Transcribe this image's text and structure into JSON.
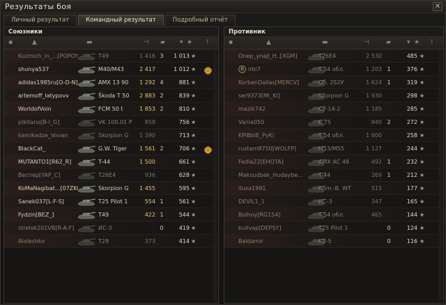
{
  "window": {
    "title": "Результаты боя",
    "close_glyph": "✕"
  },
  "tabs": [
    {
      "label": "Личный результат",
      "active": false
    },
    {
      "label": "Командный результат",
      "active": true
    },
    {
      "label": "Подробный отчёт",
      "active": false
    }
  ],
  "allies": {
    "title": "Союзники",
    "rows": [
      {
        "player": "Kuzmich_in_...[POPOY]",
        "vehicle": "T49",
        "damage": "1 416",
        "kills": "3",
        "xp": "1 013",
        "alive": false,
        "damage_low": true,
        "medal": false
      },
      {
        "player": "shunya537",
        "vehicle": "M40/M43",
        "damage": "2 417",
        "kills": "",
        "xp": "1 012",
        "alive": true,
        "damage_low": false,
        "medal": true
      },
      {
        "player": "adidas1985ru[O-D-N]",
        "vehicle": "AMX 13 90",
        "damage": "1 292",
        "kills": "4",
        "xp": "881",
        "alive": true,
        "damage_low": false,
        "medal": false
      },
      {
        "player": "artemoff_latypovv",
        "vehicle": "Škoda T 50",
        "damage": "2 883",
        "kills": "2",
        "xp": "839",
        "alive": true,
        "damage_low": false,
        "medal": false
      },
      {
        "player": "WorldofVoin",
        "vehicle": "FCM 50 t",
        "damage": "1 853",
        "kills": "2",
        "xp": "810",
        "alive": true,
        "damage_low": false,
        "medal": false
      },
      {
        "player": "pikitano[B-I_G]",
        "vehicle": "VK 100.01 P",
        "damage": "858",
        "kills": "",
        "xp": "756",
        "alive": false,
        "damage_low": true,
        "medal": false
      },
      {
        "player": "kamikadze_Vovan",
        "vehicle": "Skorpion G",
        "damage": "1 390",
        "kills": "",
        "xp": "713",
        "alive": false,
        "damage_low": true,
        "medal": false
      },
      {
        "player": "BlackCat_",
        "vehicle": "G.W. Tiger",
        "damage": "1 561",
        "kills": "2",
        "xp": "706",
        "alive": true,
        "damage_low": false,
        "medal": true
      },
      {
        "player": "MUTANTO1[R62_R]",
        "vehicle": "T-44",
        "damage": "1 500",
        "kills": "",
        "xp": "661",
        "alive": true,
        "damage_low": false,
        "medal": false
      },
      {
        "player": "Веспер[YAP_C]",
        "vehicle": "T26E4",
        "damage": "936",
        "kills": "",
        "xp": "628",
        "alive": false,
        "damage_low": true,
        "medal": false
      },
      {
        "player": "KoMaNagibat...[07ZKO]",
        "vehicle": "Skorpion G",
        "damage": "1 455",
        "kills": "",
        "xp": "595",
        "alive": true,
        "damage_low": false,
        "medal": false
      },
      {
        "player": "Sanek037[L-F-S]",
        "vehicle": "T25 Pilot 1",
        "damage": "554",
        "kills": "1",
        "xp": "561",
        "alive": true,
        "damage_low": false,
        "medal": false
      },
      {
        "player": "Fydzin[BEZ_]",
        "vehicle": "T49",
        "damage": "422",
        "kills": "1",
        "xp": "544",
        "alive": true,
        "damage_low": false,
        "medal": false
      },
      {
        "player": "strelok201VB[R-A-F]",
        "vehicle": "ИС-3",
        "damage": "",
        "kills": "0",
        "xp": "419",
        "alive": false,
        "damage_low": true,
        "medal": false
      },
      {
        "player": "Aloleshko",
        "vehicle": "T28",
        "damage": "373",
        "kills": "",
        "xp": "414",
        "alive": false,
        "damage_low": true,
        "medal": false
      }
    ]
  },
  "enemies": {
    "title": "Противник",
    "rows": [
      {
        "player": "Onep_ynaJl_H..[XGM]",
        "vehicle": "T26E4",
        "damage": "2 530",
        "kills": "",
        "xp": "485",
        "alive": false,
        "damage_low": true,
        "platoon": false
      },
      {
        "player": "irbi7",
        "vehicle": "T-54 обл.",
        "damage": "1 203",
        "kills": "1",
        "xp": "376",
        "alive": false,
        "damage_low": true,
        "platoon": true
      },
      {
        "player": "KorbenDallas[MERCV]",
        "vehicle": "Об. 252У",
        "damage": "1 624",
        "kills": "1",
        "xp": "319",
        "alive": false,
        "damage_low": true,
        "platoon": false
      },
      {
        "player": "ser9373[MI_KI]",
        "vehicle": "Skorpion G",
        "damage": "1 930",
        "kills": "",
        "xp": "298",
        "alive": false,
        "damage_low": true,
        "platoon": false
      },
      {
        "player": "mazik742",
        "vehicle": "СУ-14-2",
        "damage": "1 185",
        "kills": "",
        "xp": "285",
        "alive": false,
        "damage_low": true,
        "platoon": false
      },
      {
        "player": "Vania050",
        "vehicle": "E 75",
        "damage": "840",
        "kills": "2",
        "xp": "272",
        "alive": false,
        "damage_low": true,
        "platoon": false
      },
      {
        "player": "KPiBbIE_PyKi",
        "vehicle": "T-54 обл.",
        "damage": "1 600",
        "kills": "",
        "xp": "258",
        "alive": false,
        "damage_low": true,
        "platoon": false
      },
      {
        "player": "rustam8750[WOLFP]",
        "vehicle": "M53/M55",
        "damage": "1 127",
        "kills": "",
        "xp": "244",
        "alive": false,
        "damage_low": true,
        "platoon": false
      },
      {
        "player": "Fedia22[EHOTA]",
        "vehicle": "AMX AC 48",
        "damage": "492",
        "kills": "1",
        "xp": "232",
        "alive": false,
        "damage_low": true,
        "platoon": false
      },
      {
        "player": "Maksudbek_Hudaybe...",
        "vehicle": "T-44",
        "damage": "269",
        "kills": "1",
        "xp": "212",
        "alive": false,
        "damage_low": true,
        "platoon": false
      },
      {
        "player": "iluxa1991",
        "vehicle": "Rhm.-B. WT",
        "damage": "515",
        "kills": "",
        "xp": "177",
        "alive": false,
        "damage_low": true,
        "platoon": false
      },
      {
        "player": "DEVIL1_1",
        "vehicle": "ИС-3",
        "damage": "347",
        "kills": "",
        "xp": "165",
        "alive": false,
        "damage_low": true,
        "platoon": false
      },
      {
        "player": "Bolhoy[RG154]",
        "vehicle": "T-54 обл.",
        "damage": "465",
        "kills": "",
        "xp": "144",
        "alive": false,
        "damage_low": true,
        "platoon": false
      },
      {
        "player": "bulivap[DEPSY]",
        "vehicle": "T25 Pilot 1",
        "damage": "",
        "kills": "0",
        "xp": "124",
        "alive": false,
        "damage_low": true,
        "platoon": false
      },
      {
        "player": "Baldamir",
        "vehicle": "KB-5",
        "damage": "",
        "kills": "0",
        "xp": "116",
        "alive": false,
        "damage_low": true,
        "platoon": false
      }
    ]
  },
  "icons": {
    "star": "★",
    "sort": "▾"
  },
  "colors": {
    "accent": "#e3cc72",
    "dead_text": "#8c7e70"
  }
}
